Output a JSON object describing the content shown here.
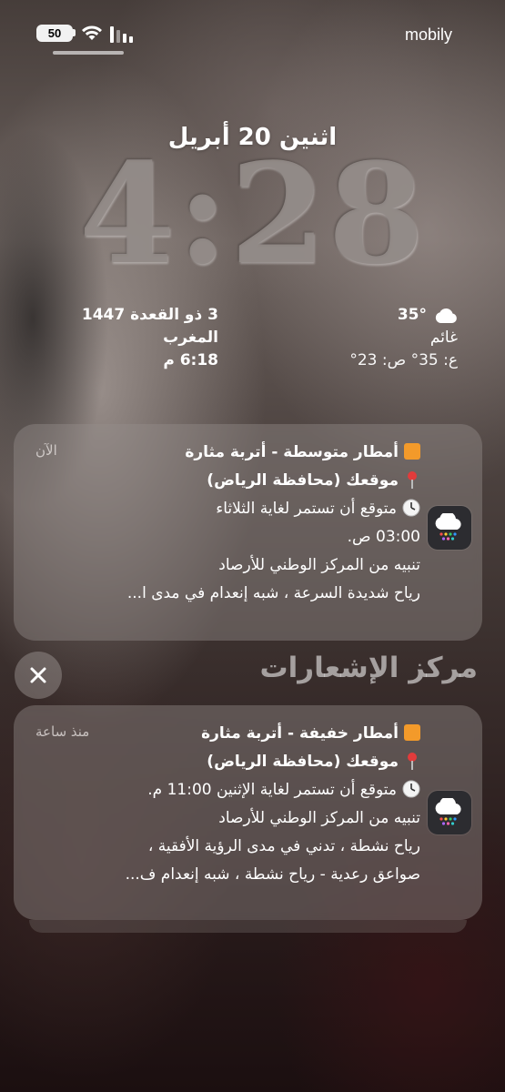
{
  "status_bar": {
    "battery_level": "50",
    "carrier": "mobily",
    "icons": [
      "battery-icon",
      "wifi-icon",
      "signal-icon"
    ]
  },
  "lock_screen": {
    "date": "اثنين 20 أبريل",
    "time": "4:28"
  },
  "widgets": {
    "hijri_prayer": {
      "hijri_date": "3 ذو القعدة 1447",
      "prayer_name": "المغرب",
      "prayer_time": "6:18 م"
    },
    "weather": {
      "temperature": "35°",
      "condition": "غائم",
      "range": "ع: 35° ص: 23°",
      "icon": "cloud-icon"
    }
  },
  "notifications": [
    {
      "time": "الآن",
      "title": "أمطار متوسطة - أتربة مثارة",
      "location": "موقعك (محافظة الرياض)",
      "duration": "متوقع أن تستمر لغاية الثلاثاء",
      "duration_cont": "03:00 ص.",
      "source": "تنبيه من المركز الوطني للأرصاد",
      "details": "رياح شديدة السرعة ، شبه إنعدام في مدى ا...",
      "details_2": "",
      "app_icon": "rain-cloud-icon"
    },
    {
      "time": "منذ ساعة",
      "title": "أمطار خفيفة - أتربة مثارة",
      "location": "موقعك (محافظة الرياض)",
      "duration": "متوقع أن تستمر لغاية الإثنين 11:00 م.",
      "duration_cont": "",
      "source": "تنبيه من المركز الوطني للأرصاد",
      "details": "رياح نشطة ، تدني في مدى الرؤية الأفقية ،",
      "details_2": "صواعق رعدية - رياح نشطة ، شبه إنعدام ف...",
      "app_icon": "rain-cloud-icon"
    }
  ],
  "notification_center": {
    "title": "مركز الإشعارات",
    "close_icon": "close-icon"
  },
  "colors": {
    "alert_orange": "#f39a2a",
    "card_bg": "rgba(150,142,140,0.42)"
  }
}
